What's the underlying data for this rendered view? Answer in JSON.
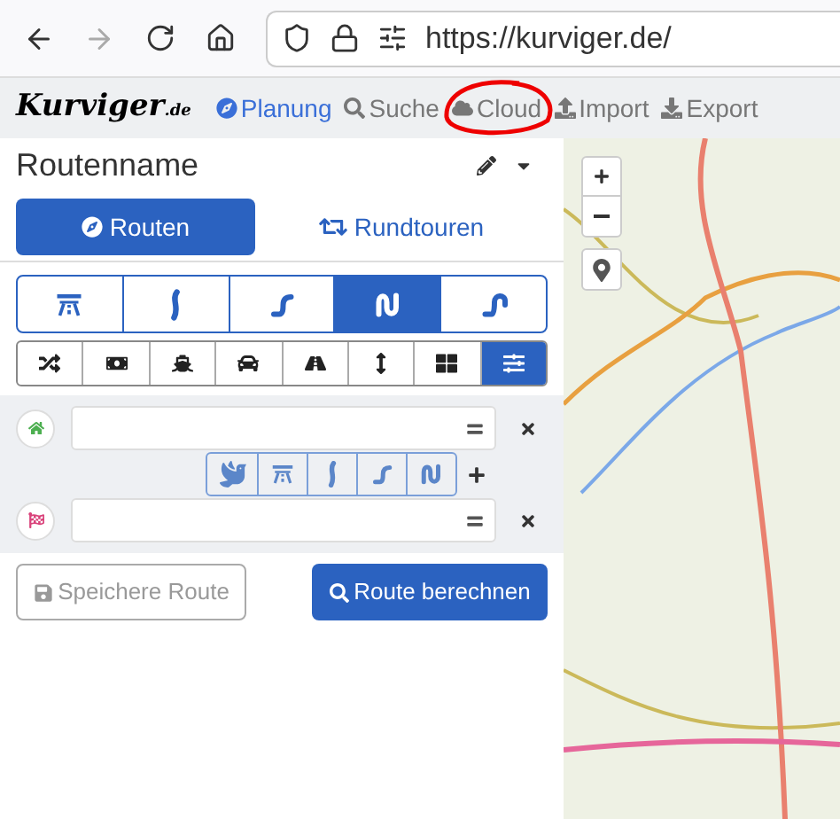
{
  "browser": {
    "back_disabled": false,
    "forward_disabled": true,
    "url": "https://kurviger.de/"
  },
  "nav": {
    "logo": "Kurviger",
    "logo_suffix": ".de",
    "items": [
      {
        "label": "Planung",
        "kind": "planning",
        "selected": true
      },
      {
        "label": "Suche",
        "kind": "search",
        "selected": false
      },
      {
        "label": "Cloud",
        "kind": "cloud",
        "selected": false
      },
      {
        "label": "Import",
        "kind": "import",
        "selected": false
      },
      {
        "label": "Export",
        "kind": "export",
        "selected": false
      }
    ]
  },
  "route_name": "Routenname",
  "mode_tabs": [
    {
      "label": "Routen",
      "kind": "routes",
      "selected": true
    },
    {
      "label": "Rundtouren",
      "kind": "roundtrip",
      "selected": false
    }
  ],
  "curviness": [
    {
      "kind": "highway",
      "selected": false
    },
    {
      "kind": "curvy1",
      "selected": false
    },
    {
      "kind": "curvy2",
      "selected": false
    },
    {
      "kind": "curvy3",
      "selected": true
    },
    {
      "kind": "curvy4",
      "selected": false
    }
  ],
  "options": [
    {
      "kind": "shuffle",
      "selected": false
    },
    {
      "kind": "toll",
      "selected": false
    },
    {
      "kind": "ferry",
      "selected": false
    },
    {
      "kind": "car",
      "selected": false
    },
    {
      "kind": "road",
      "selected": false
    },
    {
      "kind": "narrow",
      "selected": false
    },
    {
      "kind": "unpaved",
      "selected": false
    },
    {
      "kind": "settings",
      "selected": true
    }
  ],
  "waypoints": [
    {
      "kind": "start"
    },
    {
      "kind": "end"
    }
  ],
  "segment_types": [
    {
      "kind": "fastest",
      "selected": false
    },
    {
      "kind": "highway",
      "selected": false
    },
    {
      "kind": "curvy1",
      "selected": false
    },
    {
      "kind": "curvy2",
      "selected": false
    },
    {
      "kind": "curvy3",
      "selected": false
    }
  ],
  "buttons": [
    {
      "label": "Speichere Route",
      "kind": "save",
      "disabled": true
    },
    {
      "label": "Route berechnen",
      "kind": "calculate",
      "disabled": false
    }
  ],
  "annotation": {
    "circled": true
  }
}
